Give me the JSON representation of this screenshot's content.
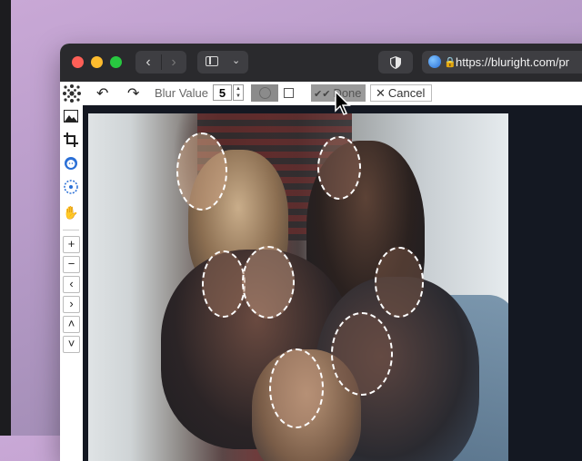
{
  "browser": {
    "url": "https://bluright.com/pr",
    "nav": {
      "back_icon": "chevron-left-icon",
      "forward_icon": "chevron-right-icon"
    }
  },
  "toolbar": {
    "undo_icon": "undo-icon",
    "redo_icon": "redo-icon",
    "blur_label": "Blur Value",
    "blur_value": "5",
    "done_label": "Done",
    "cancel_label": "Cancel"
  },
  "left_tools": [
    {
      "name": "image-icon"
    },
    {
      "name": "crop-icon"
    },
    {
      "name": "face-detect-icon"
    },
    {
      "name": "manual-blur-icon"
    },
    {
      "name": "hand-icon"
    },
    {
      "name": "zoom-in",
      "glyph": "+"
    },
    {
      "name": "zoom-out",
      "glyph": "−"
    },
    {
      "name": "pan-left",
      "glyph": "‹"
    },
    {
      "name": "pan-right",
      "glyph": "›"
    },
    {
      "name": "pan-up",
      "glyph": "˄"
    },
    {
      "name": "pan-down",
      "glyph": "˅"
    }
  ],
  "colors": {
    "accent": "#2a6fd6",
    "selection_outline": "#ffffff",
    "canvas_bg": "#141822",
    "titlebar": "#2a2a2d"
  }
}
